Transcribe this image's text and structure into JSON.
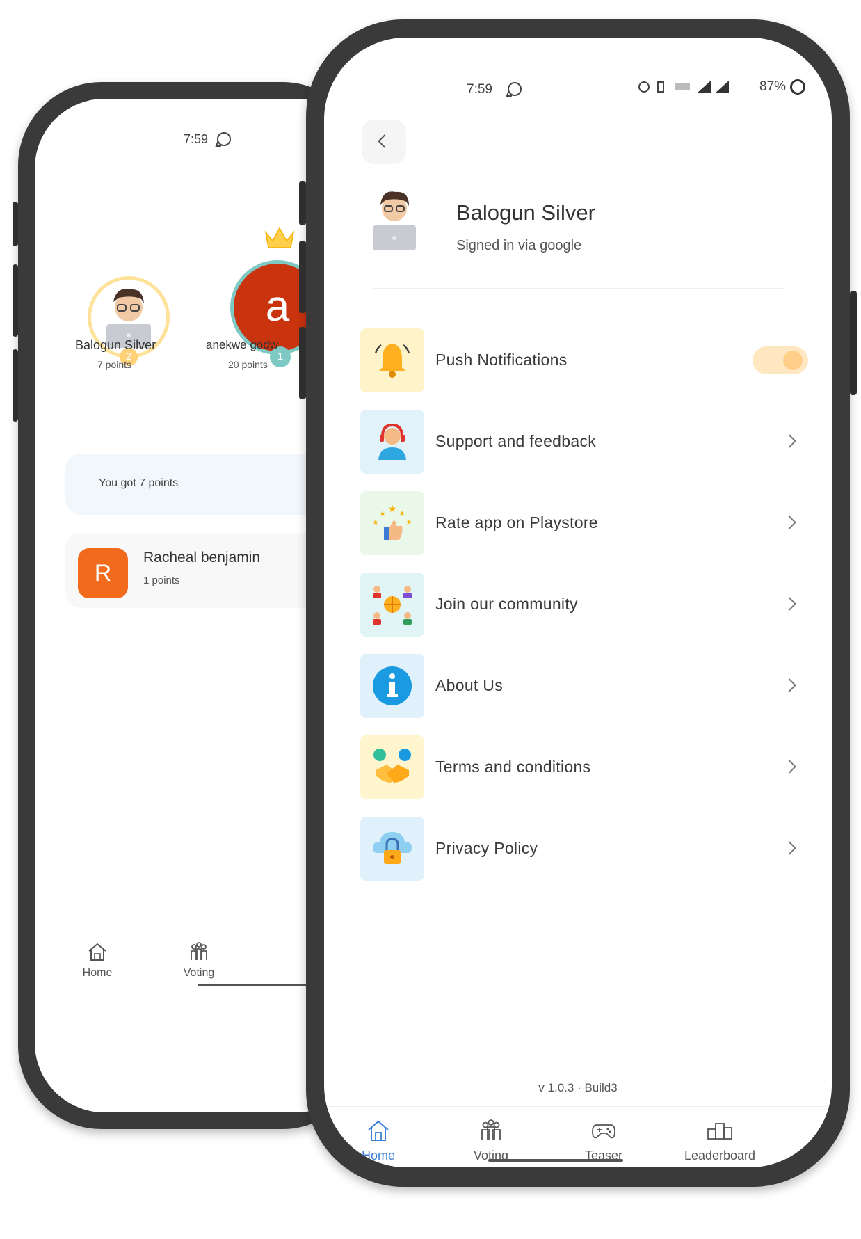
{
  "back_screen": {
    "status_time": "7:59",
    "podium": [
      {
        "rank": "2",
        "name": "Balogun Silver",
        "points": "7 points"
      },
      {
        "rank": "1",
        "initial": "a",
        "name": "anekwe godw",
        "points": "20 points"
      }
    ],
    "points_message": "You got 7 points",
    "leaderboard_row": {
      "initial": "R",
      "name": "Racheal benjamin",
      "points": "1 points"
    },
    "nav": {
      "home": "Home",
      "voting": "Voting"
    }
  },
  "front_screen": {
    "status": {
      "time": "7:59",
      "battery": "87%"
    },
    "profile": {
      "name": "Balogun Silver",
      "subtitle": "Signed in via google"
    },
    "menu": [
      {
        "label": "Push Notifications",
        "icon": "bell-icon",
        "tile_color": "#fff4c9",
        "control": "toggle",
        "toggle_on": true
      },
      {
        "label": "Support and feedback",
        "icon": "headset-agent-icon",
        "tile_color": "#e2f2fb",
        "control": "chevron"
      },
      {
        "label": "Rate app on Playstore",
        "icon": "rating-stars-icon",
        "tile_color": "#e9f8e9",
        "control": "chevron"
      },
      {
        "label": "Join our community",
        "icon": "community-globe-icon",
        "tile_color": "#e1f4f6",
        "control": "chevron"
      },
      {
        "label": "About Us",
        "icon": "info-icon",
        "tile_color": "#e1f1fb",
        "control": "chevron"
      },
      {
        "label": "Terms and conditions",
        "icon": "handshake-icon",
        "tile_color": "#fff6cf",
        "control": "chevron"
      },
      {
        "label": "Privacy Policy",
        "icon": "cloud-lock-icon",
        "tile_color": "#e1f1fb",
        "control": "chevron"
      }
    ],
    "version": "v 1.0.3  ·  Build3",
    "nav": [
      {
        "label": "Home",
        "active": true
      },
      {
        "label": "Voting",
        "active": false
      },
      {
        "label": "Teaser",
        "active": false
      },
      {
        "label": "Leaderboard",
        "active": false
      }
    ]
  },
  "colors": {
    "accent": "#3d7fd6",
    "podium_first": "#c9330e",
    "rank_avatar": "#f26b1d",
    "toggle_track": "#ffe7c2"
  }
}
